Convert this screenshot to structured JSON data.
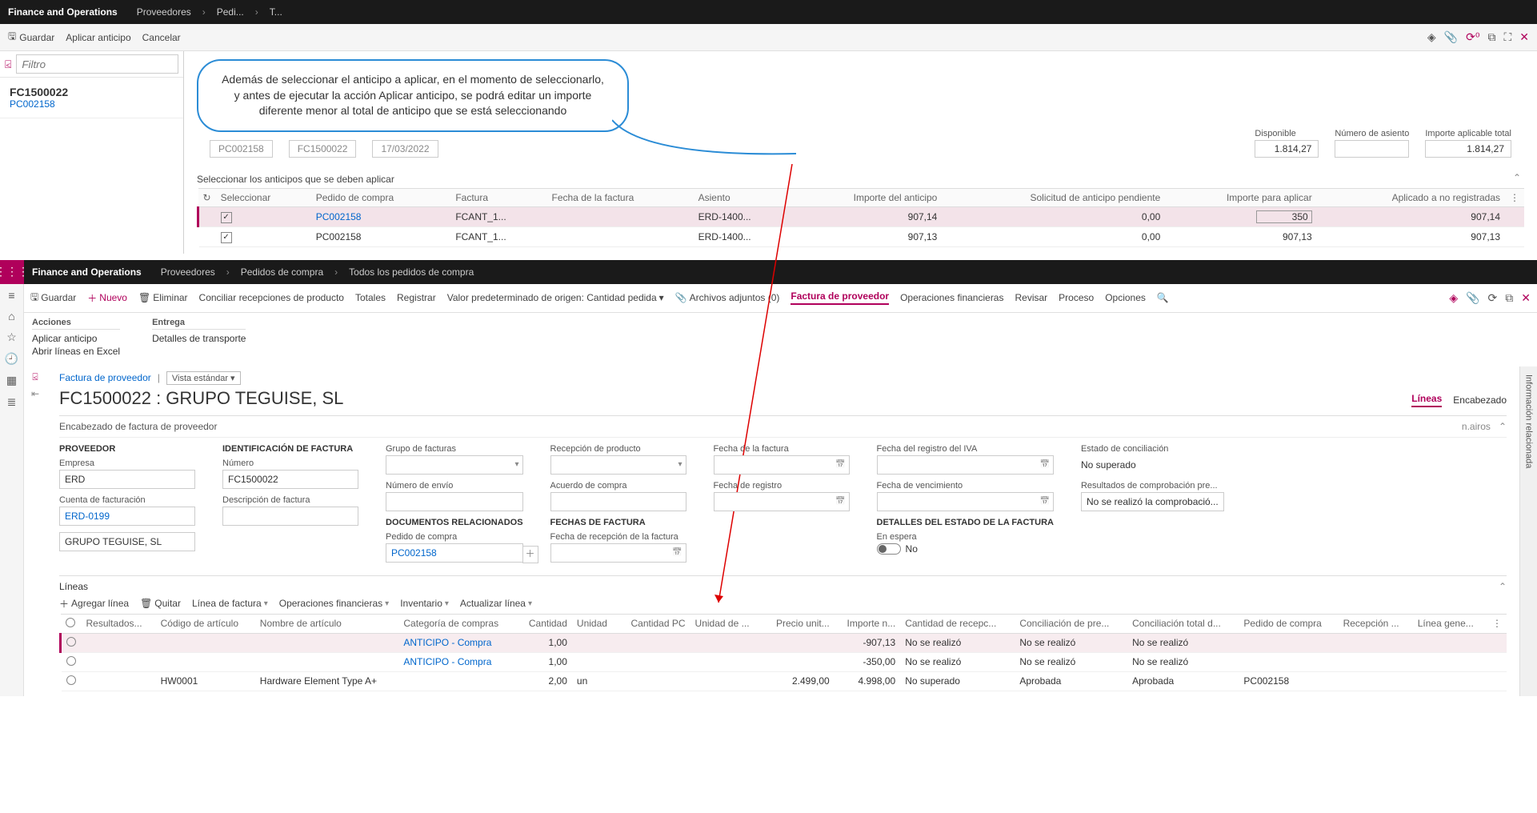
{
  "screen1": {
    "app_title": "Finance and Operations",
    "breadcrumb": [
      "Proveedores",
      "Pedi...",
      "T..."
    ],
    "toolbar": {
      "save": "Guardar",
      "apply": "Aplicar anticipo",
      "cancel": "Cancelar"
    },
    "filter_placeholder": "Filtro",
    "left_item": {
      "doc": "FC1500022",
      "sub": "PC002158"
    },
    "callout": "Además de seleccionar el anticipo a aplicar, en el momento de seleccionarlo, y antes de ejecutar la acción Aplicar anticipo, se podrá editar un importe diferente menor al total de anticipo que se está seleccionando",
    "field_stubs": [
      "PC002158",
      "FC1500022",
      "17/03/2022"
    ],
    "top_fields": {
      "disponible_label": "Disponible",
      "disponible": "1.814,27",
      "asiento_label": "Número de asiento",
      "aplicable_label": "Importe aplicable total",
      "aplicable": "1.814,27"
    },
    "section_title": "Seleccionar los anticipos que se deben aplicar",
    "grid_headers": [
      "",
      "Seleccionar",
      "Pedido de compra",
      "Factura",
      "Fecha de la factura",
      "Asiento",
      "Importe del anticipo",
      "Solicitud de anticipo pendiente",
      "Importe para aplicar",
      "Aplicado a no registradas"
    ],
    "grid_rows": [
      {
        "checked": true,
        "pedido": "PC002158",
        "factura": "FCANT_1...",
        "fecha": "",
        "asiento": "ERD-1400...",
        "importe": "907,14",
        "pendiente": "0,00",
        "aplicar": "350",
        "aplicado": "907,14",
        "editable": true
      },
      {
        "checked": true,
        "pedido": "PC002158",
        "factura": "FCANT_1...",
        "fecha": "",
        "asiento": "ERD-1400...",
        "importe": "907,13",
        "pendiente": "0,00",
        "aplicar": "907,13",
        "aplicado": "907,13",
        "editable": false
      }
    ]
  },
  "screen2": {
    "app_title": "Finance and Operations",
    "breadcrumb": [
      "Proveedores",
      "Pedidos de compra",
      "Todos los pedidos de compra"
    ],
    "toolbar": {
      "save": "Guardar",
      "new": "Nuevo",
      "delete": "Eliminar",
      "conciliar": "Conciliar recepciones de producto",
      "totales": "Totales",
      "registrar": "Registrar",
      "default": "Valor predeterminado de origen: Cantidad pedida",
      "attach": "Archivos adjuntos (0)",
      "factura": "Factura de proveedor",
      "finops": "Operaciones financieras",
      "revisar": "Revisar",
      "proceso": "Proceso",
      "opciones": "Opciones"
    },
    "sub": {
      "acciones_head": "Acciones",
      "entrega_head": "Entrega",
      "aplicar": "Aplicar anticipo",
      "excel": "Abrir líneas en Excel",
      "transporte": "Detalles de transporte"
    },
    "crumb_link": "Factura de proveedor",
    "view": "Vista estándar",
    "page_h1": "FC1500022 : GRUPO TEGUISE, SL",
    "tabs": {
      "lineas": "Líneas",
      "encabezado": "Encabezado"
    },
    "encabez_title": "Encabezado de factura de proveedor",
    "encabez_user": "n.airos",
    "form": {
      "proveedor_h": "PROVEEDOR",
      "empresa_l": "Empresa",
      "empresa": "ERD",
      "cuenta_l": "Cuenta de facturación",
      "cuenta": "ERD-0199",
      "grupo": "GRUPO TEGUISE, SL",
      "ident_h": "IDENTIFICACIÓN DE FACTURA",
      "numero_l": "Número",
      "numero": "FC1500022",
      "desc_l": "Descripción de factura",
      "grupo_fact_l": "Grupo de facturas",
      "envio_l": "Número de envío",
      "doc_rel_h": "DOCUMENTOS RELACIONADOS",
      "pedido_l": "Pedido de compra",
      "pedido": "PC002158",
      "recep_l": "Recepción de producto",
      "acuerdo_l": "Acuerdo de compra",
      "fechas_h": "FECHAS DE FACTURA",
      "recep_fecha_l": "Fecha de recepción de la factura",
      "fecha_fact_l": "Fecha de la factura",
      "fecha_reg_l": "Fecha de registro",
      "iva_l": "Fecha del registro del IVA",
      "venc_l": "Fecha de vencimiento",
      "det_h": "DETALLES DEL ESTADO DE LA FACTURA",
      "espera_l": "En espera",
      "no": "No",
      "estado_l": "Estado de conciliación",
      "estado": "No superado",
      "comprob_l": "Resultados de comprobación pre...",
      "comprob": "No se realizó la comprobació..."
    },
    "lines": {
      "title": "Líneas",
      "toolbar": {
        "add": "Agregar línea",
        "remove": "Quitar",
        "linea": "Línea de factura",
        "finops": "Operaciones financieras",
        "inv": "Inventario",
        "act": "Actualizar línea"
      },
      "headers": [
        "",
        "Resultados...",
        "Código de artículo",
        "Nombre de artículo",
        "Categoría de compras",
        "Cantidad",
        "Unidad",
        "Cantidad PC",
        "Unidad de ...",
        "Precio unit...",
        "Importe n...",
        "Cantidad de recepc...",
        "Conciliación de pre...",
        "Conciliación total d...",
        "Pedido de compra",
        "Recepción ...",
        "Línea gene..."
      ],
      "rows": [
        {
          "cod": "",
          "nombre": "",
          "cat": "ANTICIPO - Compra",
          "cant": "1,00",
          "un": "",
          "cantpc": "",
          "unde": "",
          "precio": "",
          "importe": "-907,13",
          "recepc": "No se realizó",
          "conc_pre": "No se realizó",
          "conc_tot": "No se realizó",
          "pedido": ""
        },
        {
          "cod": "",
          "nombre": "",
          "cat": "ANTICIPO - Compra",
          "cant": "1,00",
          "un": "",
          "cantpc": "",
          "unde": "",
          "precio": "",
          "importe": "-350,00",
          "recepc": "No se realizó",
          "conc_pre": "No se realizó",
          "conc_tot": "No se realizó",
          "pedido": ""
        },
        {
          "cod": "HW0001",
          "nombre": "Hardware Element Type A+",
          "cat": "",
          "cant": "2,00",
          "un": "un",
          "cantpc": "",
          "unde": "",
          "precio": "2.499,00",
          "importe": "4.998,00",
          "recepc": "No superado",
          "conc_pre": "Aprobada",
          "conc_tot": "Aprobada",
          "pedido": "PC002158"
        }
      ]
    },
    "info_rail": "Información relacionada"
  }
}
